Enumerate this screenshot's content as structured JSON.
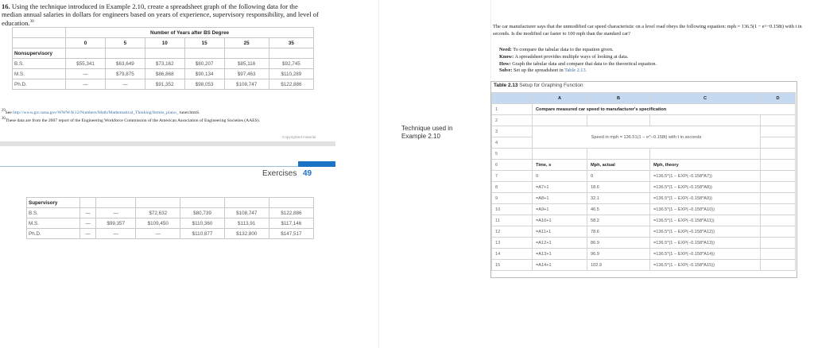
{
  "problem": {
    "number": "16.",
    "text": "Using the technique introduced in Example 2.10, create a spreadsheet graph of the following data for the median annual salaries in dollars for engineers based on years of experience, supervisory responsibility, and level of education.",
    "footnote_ref": "30"
  },
  "salary_table": {
    "header": "Number of Years after BS Degree",
    "years": [
      "0",
      "5",
      "10",
      "15",
      "25",
      "35"
    ],
    "nonsupervisory": {
      "label": "Nonsupervisory",
      "rows": [
        {
          "degree": "B.S.",
          "values": [
            "$55,341",
            "$63,649",
            "$73,162",
            "$80,207",
            "$85,116",
            "$92,745"
          ]
        },
        {
          "degree": "M.S.",
          "values": [
            "—",
            "$79,875",
            "$86,868",
            "$90,134",
            "$97,463",
            "$110,289"
          ]
        },
        {
          "degree": "Ph.D.",
          "values": [
            "—",
            "—",
            "$91,352",
            "$98,053",
            "$108,747",
            "$122,886"
          ]
        }
      ]
    },
    "supervisory": {
      "label": "Supervisory",
      "rows": [
        {
          "degree": "B.S.",
          "values": [
            "—",
            "—",
            "$72,632",
            "$80,739",
            "$108,747",
            "$122,886"
          ]
        },
        {
          "degree": "M.S.",
          "values": [
            "—",
            "$99,357",
            "$109,450",
            "$110,360",
            "$113,91",
            "$117,146"
          ]
        },
        {
          "degree": "Ph.D.",
          "values": [
            "—",
            "—",
            "—",
            "$110,877",
            "$132,800",
            "$147,517"
          ]
        }
      ]
    }
  },
  "footnotes": {
    "f29_num": "29",
    "f29_prefix": "See ",
    "f29_link": "http://www.grc.nasa.gov/WWW/K12/Numbers/Math/Mathematical_Thinking/fermis_piano_",
    "f29_suffix": " tuner.htmS.",
    "f30_num": "30",
    "f30": "These data are from the 2007 report of the Engineering Workforce Commission of the American Association of Engineering Societies (AAES)."
  },
  "copyright": "Copyrighted material",
  "page_footer": {
    "section": "Exercises",
    "page": "49"
  },
  "side_note": {
    "line1": "Technique used in",
    "line2": "Example 2.10"
  },
  "right_text": {
    "intro": "The car manufacturer says that the unmodified car speed characteristic on a level road obeys the following equation: mph = 136.5(1 − e^−0.158t) with t in seconds. Is the modified car faster to 100 mph than the standard car?",
    "need_label": "Need:",
    "need": "To compare the tabular data to the equation given.",
    "know_label": "Know:",
    "know": "A spreadsheet provides multiple ways of looking at data.",
    "how_label": "How:",
    "how": "Graph the tabular data and compare that data to the theoretical equation.",
    "solve_label": "Solve:",
    "solve": "Set up the spreadsheet in ",
    "solve_link": "Table 2.13."
  },
  "spreadsheet": {
    "title_num": "Table 2.13",
    "title": "Setup for Graphing Function",
    "columns": [
      "A",
      "B",
      "C",
      "D"
    ],
    "row_numbers": [
      "1",
      "2",
      "3",
      "4",
      "5",
      "6"
    ],
    "row1": "Compare measured car speed to manufacturer's specification",
    "formula_note": "Speed in mph = 136.51(1 − e^−0.158t) with t in seconds",
    "headers": [
      "Time, s",
      "Mph, actual",
      "Mph, theory"
    ],
    "data": [
      {
        "row": "7",
        "a": "0",
        "b": "0",
        "c": "=136.5*(1 − EXP(−0.158*A7))"
      },
      {
        "row": "8",
        "a": "=A7+1",
        "b": "18.6",
        "c": "=136.5*(1 − EXP(−0.158*A8))"
      },
      {
        "row": "9",
        "a": "=A8+1",
        "b": "32.1",
        "c": "=136.5*(1 − EXP(−0.158*A9))"
      },
      {
        "row": "10",
        "a": "=A9+1",
        "b": "46.5",
        "c": "=136.5*(1 − EXP(−0.158*A10))"
      },
      {
        "row": "11",
        "a": "=A10+1",
        "b": "58.2",
        "c": "=136.5*(1 − EXP(−0.158*A11))"
      },
      {
        "row": "12",
        "a": "=A11+1",
        "b": "78.6",
        "c": "=136.5*(1 − EXP(−0.158*A12))"
      },
      {
        "row": "13",
        "a": "=A12+1",
        "b": "86.9",
        "c": "=136.5*(1 − EXP(−0.158*A13))"
      },
      {
        "row": "14",
        "a": "=A13+1",
        "b": "96.9",
        "c": "=136.5*(1 − EXP(−0.158*A14))"
      },
      {
        "row": "15",
        "a": "=A14+1",
        "b": "102.9",
        "c": "=136.5*(1 − EXP(−0.158*A15))"
      }
    ]
  }
}
